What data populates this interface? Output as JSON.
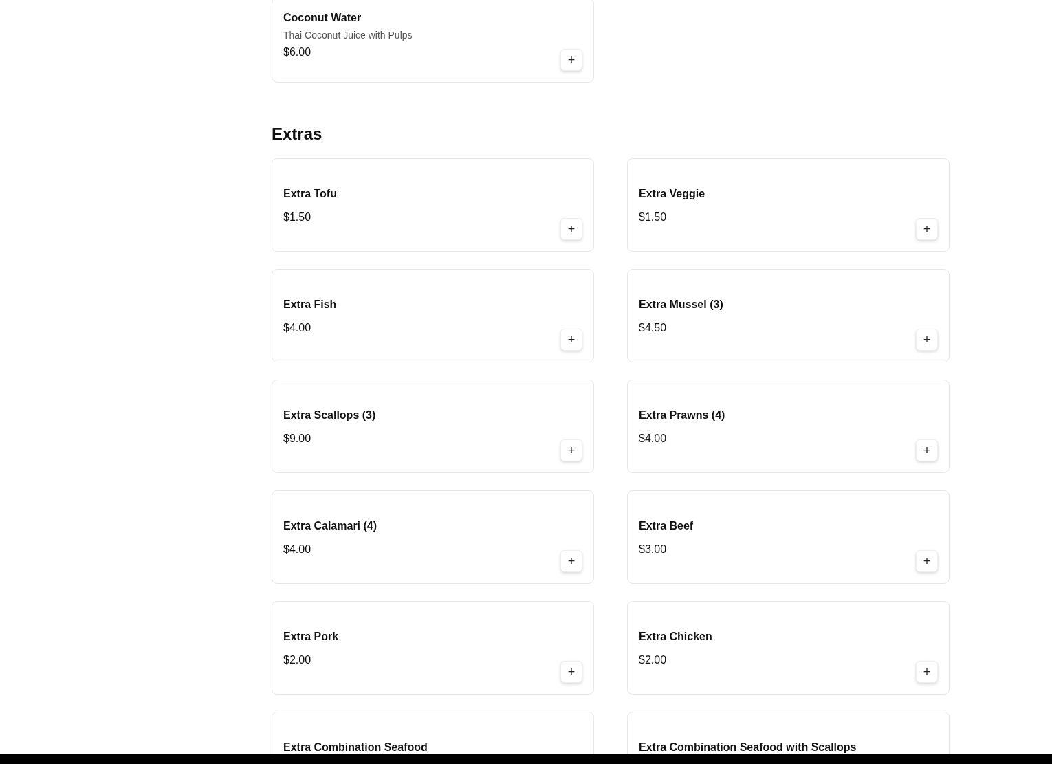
{
  "sections": [
    {
      "items": [
        {
          "name": "Coconut Water",
          "description": "Thai Coconut Juice with Pulps",
          "price": "$6.00",
          "add": "+"
        }
      ]
    },
    {
      "title": "Extras",
      "items": [
        {
          "name": "Extra Tofu",
          "price": "$1.50",
          "add": "+"
        },
        {
          "name": "Extra Veggie",
          "price": "$1.50",
          "add": "+"
        },
        {
          "name": "Extra Fish",
          "price": "$4.00",
          "add": "+"
        },
        {
          "name": "Extra Mussel (3)",
          "price": "$4.50",
          "add": "+"
        },
        {
          "name": "Extra Scallops (3)",
          "price": "$9.00",
          "add": "+"
        },
        {
          "name": "Extra Prawns (4)",
          "price": "$4.00",
          "add": "+"
        },
        {
          "name": "Extra Calamari (4)",
          "price": "$4.00",
          "add": "+"
        },
        {
          "name": "Extra Beef",
          "price": "$3.00",
          "add": "+"
        },
        {
          "name": "Extra Pork",
          "price": "$2.00",
          "add": "+"
        },
        {
          "name": "Extra Chicken",
          "price": "$2.00",
          "add": "+"
        },
        {
          "name": "Extra Combination Seafood"
        },
        {
          "name": "Extra Combination Seafood with Scallops"
        }
      ]
    }
  ]
}
